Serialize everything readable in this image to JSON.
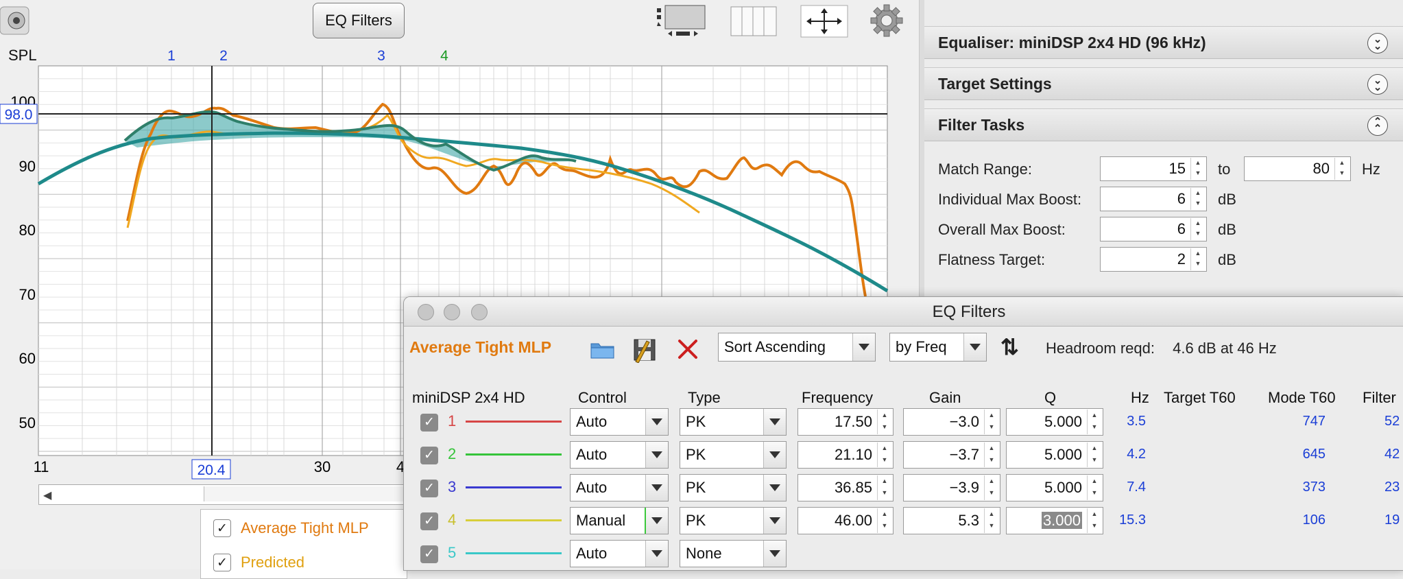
{
  "graph": {
    "eq_button": "EQ Filters",
    "spl_label": "SPL",
    "y_ticks": [
      "100",
      "90",
      "80",
      "70",
      "60",
      "50"
    ],
    "cursor_y": "98.0",
    "cursor_x": "20.4",
    "x_ticks": [
      "11",
      "30",
      "4"
    ],
    "filter_markers": [
      {
        "label": "1",
        "color": "#1a3ed6"
      },
      {
        "label": "2",
        "color": "#1a3ed6"
      },
      {
        "label": "3",
        "color": "#1a3ed6"
      },
      {
        "label": "4",
        "color": "#1a9a22"
      }
    ],
    "icons": [
      "speaker-icon",
      "layout-icon",
      "columns-icon",
      "move-icon",
      "gear-icon"
    ]
  },
  "legend": {
    "items": [
      {
        "label": "Average Tight MLP",
        "checked": true,
        "color": "#e07a10"
      },
      {
        "label": "Predicted",
        "checked": true,
        "color": "#e0a010"
      }
    ]
  },
  "right_panel": {
    "sections": [
      {
        "title": "Equaliser: miniDSP 2x4 HD (96 kHz)",
        "state": "collapsed"
      },
      {
        "title": "Target Settings",
        "state": "collapsed"
      },
      {
        "title": "Filter Tasks",
        "state": "expanded"
      }
    ],
    "filter_tasks": {
      "match_range_label": "Match Range:",
      "match_from": "15",
      "to_label": "to",
      "match_to": "80",
      "hz_unit": "Hz",
      "ind_boost_label": "Individual Max Boost:",
      "ind_boost": "6",
      "overall_boost_label": "Overall Max Boost:",
      "overall_boost": "6",
      "flatness_label": "Flatness Target:",
      "flatness": "2",
      "db_unit": "dB"
    }
  },
  "eq_window": {
    "title": "EQ Filters",
    "measurement": "Average Tight MLP",
    "sort_value": "Sort Ascending",
    "by_value": "by Freq",
    "headroom_label": "Headroom reqd:",
    "headroom_value": "4.6 dB at 46 Hz",
    "columns": {
      "device": "miniDSP 2x4 HD",
      "control": "Control",
      "type": "Type",
      "frequency": "Frequency",
      "gain": "Gain",
      "q": "Q",
      "hz": "Hz",
      "target_t60": "Target T60",
      "mode_t60": "Mode T60",
      "filter": "Filter"
    },
    "rows": [
      {
        "num": "1",
        "color": "#d64545",
        "control": "Auto",
        "type": "PK",
        "freq": "17.50",
        "gain": "−3.0",
        "q": "5.000",
        "hz": "3.5",
        "mode_t60": "747",
        "filter": "52"
      },
      {
        "num": "2",
        "color": "#35c43a",
        "control": "Auto",
        "type": "PK",
        "freq": "21.10",
        "gain": "−3.7",
        "q": "5.000",
        "hz": "4.2",
        "mode_t60": "645",
        "filter": "42"
      },
      {
        "num": "3",
        "color": "#3a3ad0",
        "control": "Auto",
        "type": "PK",
        "freq": "36.85",
        "gain": "−3.9",
        "q": "5.000",
        "hz": "7.4",
        "mode_t60": "373",
        "filter": "23"
      },
      {
        "num": "4",
        "color": "#d8cf3a",
        "control": "Manual",
        "type": "PK",
        "freq": "46.00",
        "gain": "5.3",
        "q": "3.000",
        "hz": "15.3",
        "mode_t60": "106",
        "filter": "19"
      },
      {
        "num": "5",
        "color": "#3ac8c8",
        "control": "Auto",
        "type": "None",
        "freq": "",
        "gain": "",
        "q": "",
        "hz": "",
        "mode_t60": "",
        "filter": ""
      }
    ]
  }
}
